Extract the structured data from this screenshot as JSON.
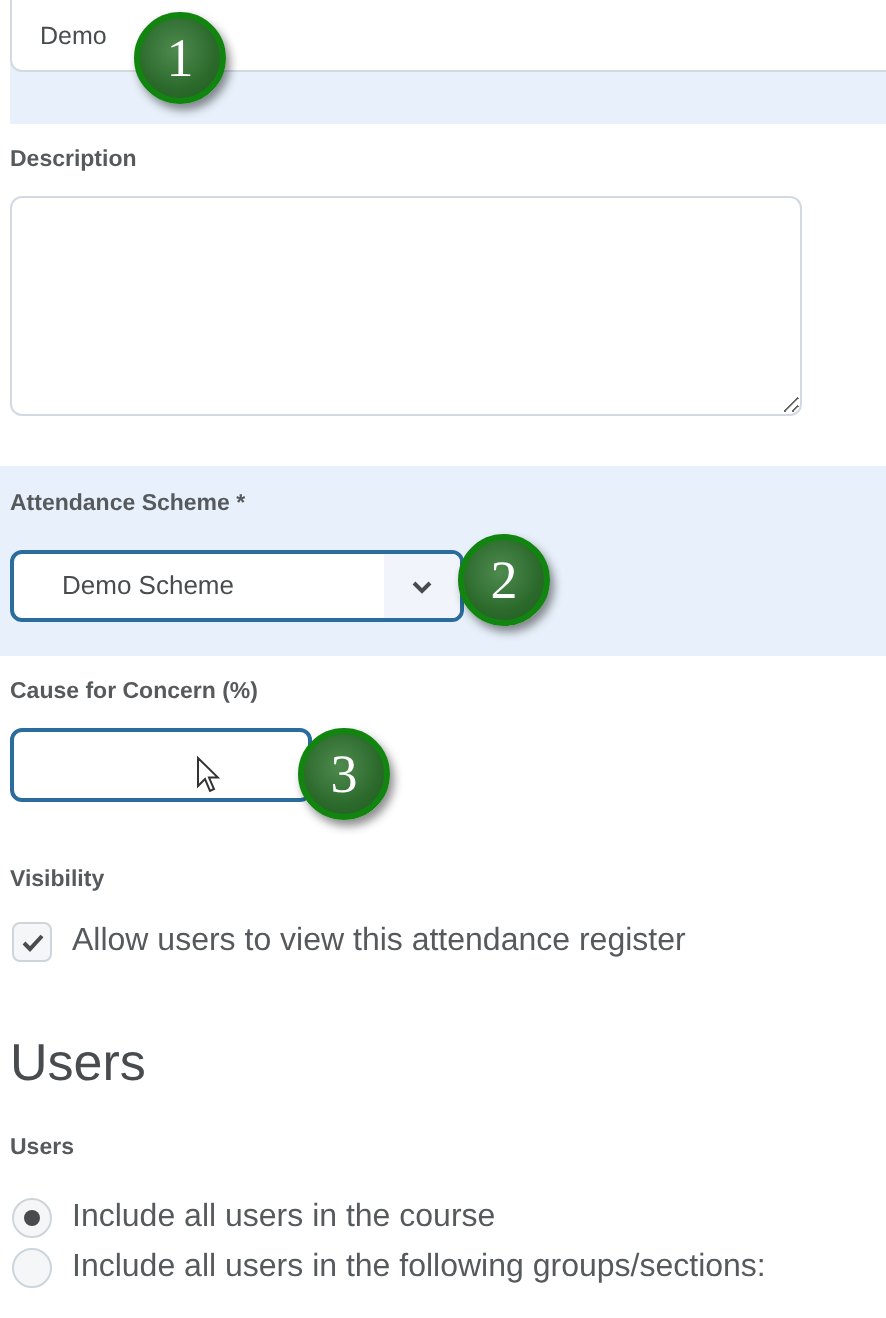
{
  "name_field": {
    "value": "Demo",
    "callout": "1"
  },
  "description": {
    "label": "Description"
  },
  "attendance_scheme": {
    "label": "Attendance Scheme",
    "required_mark": "*",
    "value": "Demo Scheme",
    "callout": "2"
  },
  "cause_for_concern": {
    "label": "Cause for Concern (%)",
    "callout": "3"
  },
  "visibility": {
    "label": "Visibility",
    "checkbox": {
      "label": "Allow users to view this attendance register",
      "checked": true
    }
  },
  "users_section": {
    "heading": "Users",
    "label": "Users",
    "options": [
      {
        "label": "Include all users in the course",
        "selected": true
      },
      {
        "label": "Include all users in the following groups/sections:",
        "selected": false
      }
    ]
  }
}
